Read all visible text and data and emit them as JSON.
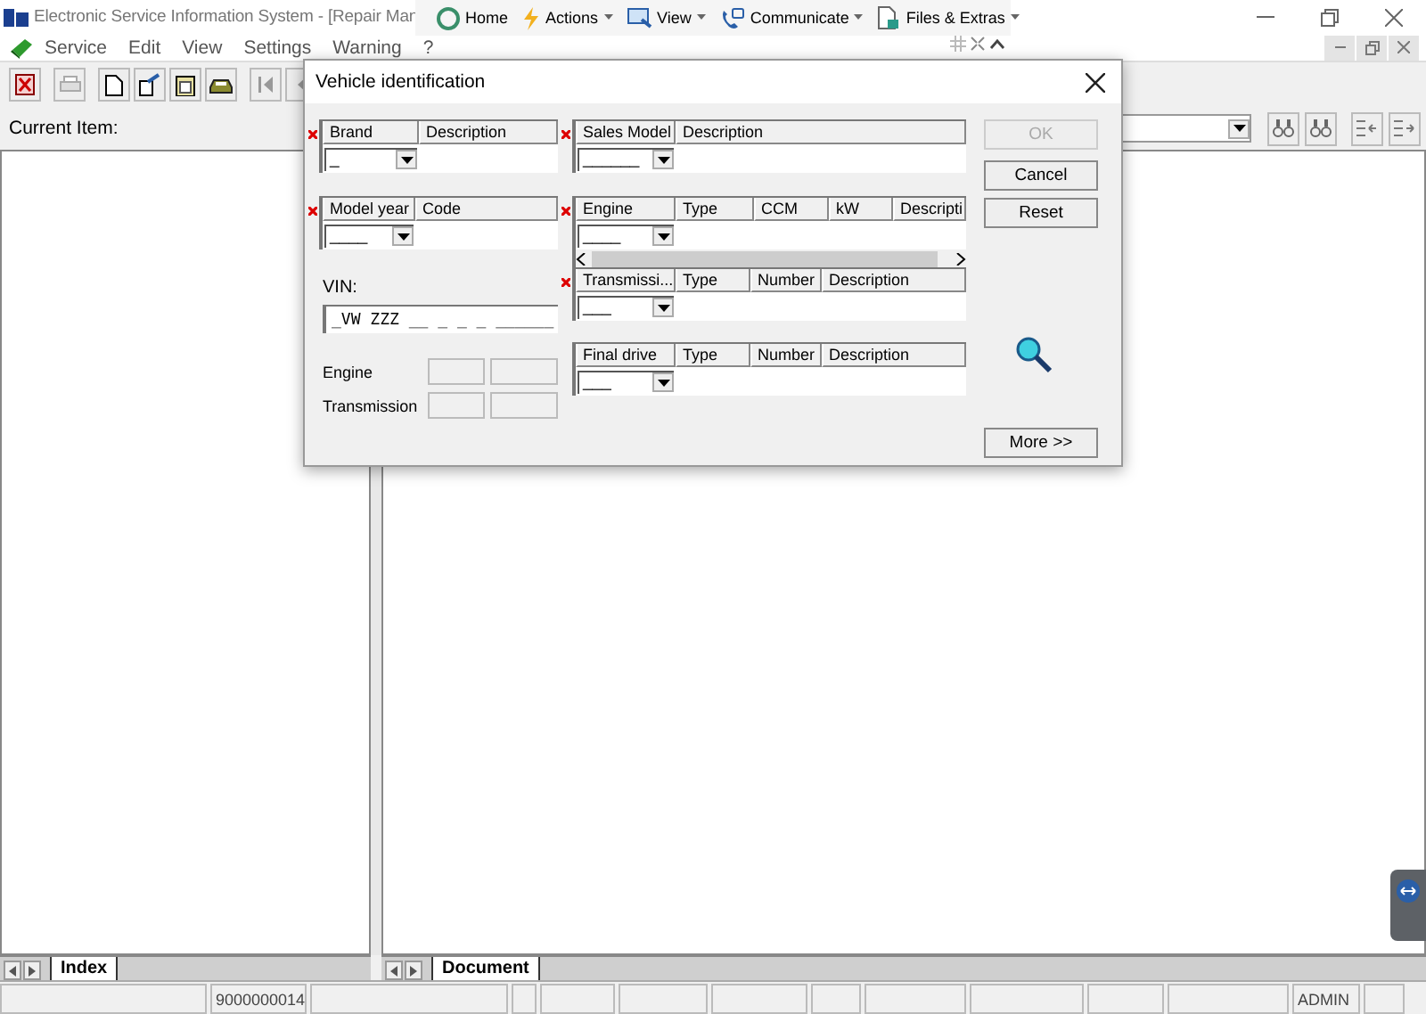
{
  "window": {
    "title": "Electronic Service Information System - [Repair Man"
  },
  "quick_toolbar": [
    {
      "label": "Home",
      "dropdown": false,
      "kind": "home"
    },
    {
      "label": "Actions",
      "dropdown": true,
      "kind": "actions"
    },
    {
      "label": "View",
      "dropdown": true,
      "kind": "view"
    },
    {
      "label": "Communicate",
      "dropdown": true,
      "kind": "communicate"
    },
    {
      "label": "Files & Extras",
      "dropdown": true,
      "kind": "files"
    }
  ],
  "menu": [
    "Service",
    "Edit",
    "View",
    "Settings",
    "Warning",
    "?"
  ],
  "current_item": {
    "label": "Current Item:"
  },
  "left_tab": {
    "label": "Index"
  },
  "right_tab": {
    "label": "Document"
  },
  "status_bar": {
    "item_code": "9000000014",
    "user": "ADMIN"
  },
  "dialog": {
    "title": "Vehicle identification",
    "left_groups": [
      {
        "required": true,
        "columns": [
          "Brand",
          "Description"
        ],
        "value": "_"
      },
      {
        "required": true,
        "columns": [
          "Model year",
          "Code"
        ],
        "value": "____"
      }
    ],
    "vin": {
      "label": "VIN:",
      "value": "_VW ZZZ __ _ _ _ ______"
    },
    "code_fields": [
      {
        "label": "Engine"
      },
      {
        "label": "Transmission"
      }
    ],
    "right_groups": [
      {
        "required": true,
        "kind": "plain",
        "columns": [
          "Sales Model",
          "Description"
        ],
        "value": "______"
      },
      {
        "required": true,
        "kind": "scrollable",
        "columns": [
          "Engine",
          "Type",
          "CCM",
          "kW",
          "Descripti"
        ],
        "value": "____"
      },
      {
        "required": true,
        "kind": "plain",
        "columns": [
          "Transmissi...",
          "Type",
          "Number",
          "Description"
        ],
        "value": "___"
      },
      {
        "required": false,
        "kind": "plain",
        "columns": [
          "Final drive",
          "Type",
          "Number",
          "Description"
        ],
        "value": "___"
      }
    ],
    "buttons": [
      {
        "label": "OK",
        "disabled": true
      },
      {
        "label": "Cancel",
        "disabled": false
      },
      {
        "label": "Reset",
        "disabled": false
      }
    ],
    "more_button": {
      "label": "More >>"
    }
  }
}
